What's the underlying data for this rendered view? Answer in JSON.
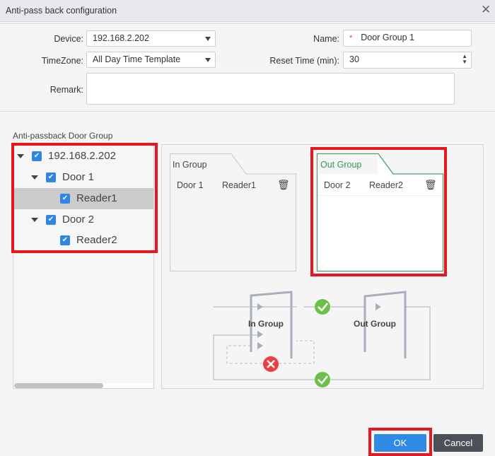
{
  "dialog": {
    "title": "Anti-pass back configuration"
  },
  "form": {
    "device_label": "Device:",
    "device_value": "192.168.2.202",
    "timezone_label": "TimeZone:",
    "timezone_value": "All Day Time Template",
    "remark_label": "Remark:",
    "remark_value": "",
    "name_label": "Name:",
    "name_required": "*",
    "name_value": "Door Group 1",
    "reset_label": "Reset Time (min):",
    "reset_value": "30"
  },
  "tree": {
    "title": "Anti-passback Door Group",
    "items": [
      {
        "label": "192.168.2.202",
        "checked": true
      },
      {
        "label": "Door 1",
        "checked": true
      },
      {
        "label": "Reader1",
        "checked": true,
        "selected": true
      },
      {
        "label": "Door 2",
        "checked": true
      },
      {
        "label": "Reader2",
        "checked": true
      }
    ]
  },
  "groups": {
    "in": {
      "title": "In Group",
      "door": "Door 1",
      "reader": "Reader1"
    },
    "out": {
      "title": "Out Group",
      "door": "Door 2",
      "reader": "Reader2"
    }
  },
  "diagram": {
    "in_label": "In Group",
    "out_label": "Out Group"
  },
  "footer": {
    "ok": "OK",
    "cancel": "Cancel"
  },
  "colors": {
    "accent": "#2f86e4",
    "highlight": "#e8161d",
    "out_group": "#2e9b4f",
    "ok_button": "#2f8ae5",
    "cancel_button": "#4b5157"
  }
}
